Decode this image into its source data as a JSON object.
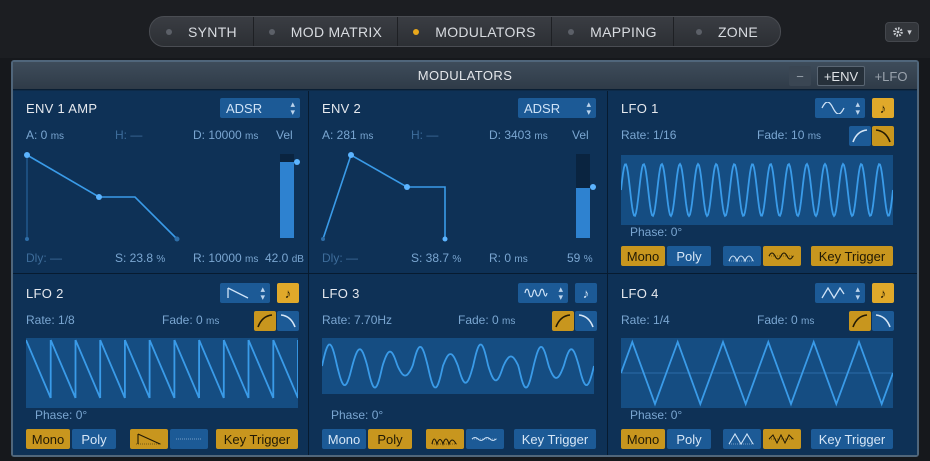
{
  "tabs": [
    {
      "label": "SYNTH",
      "active": false
    },
    {
      "label": "MOD MATRIX",
      "active": false
    },
    {
      "label": "MODULATORS",
      "active": true
    },
    {
      "label": "MAPPING",
      "active": false
    },
    {
      "label": "ZONE",
      "active": false
    }
  ],
  "settings_icon": "gear-icon",
  "panel": {
    "title": "MODULATORS",
    "minus_label": "−",
    "add_env_label": "+ENV",
    "add_lfo_label": "+LFO"
  },
  "env1": {
    "title": "ENV 1 AMP",
    "mode": "ADSR",
    "attack": "A: 0",
    "attack_unit": "ms",
    "hold": "H: —",
    "decay": "D: 10000",
    "decay_unit": "ms",
    "vel_label": "Vel",
    "delay": "Dly: —",
    "sustain": "S: 23.8",
    "sustain_unit": "%",
    "release": "R: 10000",
    "release_unit": "ms",
    "vel_value": "42.0",
    "vel_unit": "dB",
    "vel_level": 0.9
  },
  "env2": {
    "title": "ENV 2",
    "mode": "ADSR",
    "attack": "A: 281",
    "attack_unit": "ms",
    "hold": "H: —",
    "decay": "D: 3403",
    "decay_unit": "ms",
    "vel_label": "Vel",
    "delay": "Dly: —",
    "sustain": "S: 38.7",
    "sustain_unit": "%",
    "release": "R: 0",
    "release_unit": "ms",
    "vel_value": "59",
    "vel_unit": "%",
    "vel_level": 0.59
  },
  "lfo1": {
    "title": "LFO 1",
    "wave_icon": "sine-wave-icon",
    "rate": "Rate: 1/16",
    "fade": "Fade: 10",
    "fade_unit": "ms",
    "phase": "Phase: 0°",
    "mono_label": "Mono",
    "poly_label": "Poly",
    "key_trigger_label": "Key Trigger",
    "mono_active": true
  },
  "lfo2": {
    "title": "LFO 2",
    "wave_icon": "sawtooth-wave-icon",
    "rate": "Rate: 1/8",
    "fade": "Fade: 0",
    "fade_unit": "ms",
    "phase": "Phase: 0°",
    "mono_label": "Mono",
    "poly_label": "Poly",
    "key_trigger_label": "Key Trigger",
    "mono_active": true
  },
  "lfo3": {
    "title": "LFO 3",
    "wave_icon": "random-wave-icon",
    "rate": "Rate: 7.70Hz",
    "fade": "Fade: 0",
    "fade_unit": "ms",
    "phase": "Phase: 0°",
    "mono_label": "Mono",
    "poly_label": "Poly",
    "key_trigger_label": "Key Trigger",
    "mono_active": false
  },
  "lfo4": {
    "title": "LFO 4",
    "wave_icon": "triangle-wave-icon",
    "rate": "Rate: 1/4",
    "fade": "Fade: 0",
    "fade_unit": "ms",
    "phase": "Phase: 0°",
    "mono_label": "Mono",
    "poly_label": "Poly",
    "key_trigger_label": "Key Trigger",
    "mono_active": true
  },
  "colors": {
    "accent": "#e0a92a",
    "panel": "#0e3156",
    "control": "#1c5a96",
    "curve": "#3a9be8"
  }
}
